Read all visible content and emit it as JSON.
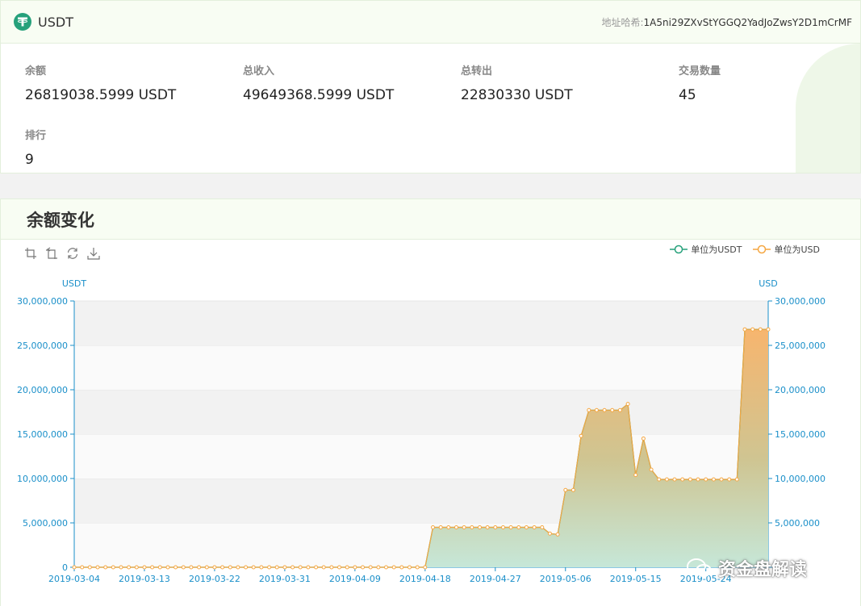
{
  "header": {
    "token_name": "USDT",
    "token_symbol_glyph": "T",
    "address_label": "地址哈希:",
    "address_value": "1A5ni29ZXvStYGGQ2YadJoZwsY2D1mCrMF"
  },
  "stats": [
    {
      "label": "余额",
      "value": "26819038.5999 USDT"
    },
    {
      "label": "总收入",
      "value": "49649368.5999 USDT"
    },
    {
      "label": "总转出",
      "value": "22830330 USDT"
    },
    {
      "label": "交易数量",
      "value": "45"
    },
    {
      "label": "排行",
      "value": "9"
    }
  ],
  "chart_section": {
    "title": "余额变化"
  },
  "toolbox": [
    "zoom-icon",
    "zoom-reset-icon",
    "restore-icon",
    "download-icon"
  ],
  "colors": {
    "accent": "#26a17b",
    "series_usdt": "#26a17b",
    "series_usd": "#f5a742",
    "axis": "#1a8fc9"
  },
  "watermark": {
    "text": "资金盘解读"
  },
  "chart_data": {
    "type": "area",
    "title": "",
    "xlabel": "",
    "ylabel_left": "USDT",
    "ylabel_right": "USD",
    "ylim": [
      0,
      30000000
    ],
    "yticks": [
      "0",
      "5,000,000",
      "10,000,000",
      "15,000,000",
      "20,000,000",
      "25,000,000",
      "30,000,000"
    ],
    "xtick_labels": [
      "2019-03-04",
      "2019-03-13",
      "2019-03-22",
      "2019-03-31",
      "2019-04-09",
      "2019-04-18",
      "2019-04-27",
      "2019-05-06",
      "2019-05-15",
      "2019-05-24"
    ],
    "x_start": "2019-03-04",
    "x_end": "2019-06-01",
    "legend_position": "top-right",
    "grid": true,
    "series": [
      {
        "name": "单位为USDT",
        "values": "same as 单位为USD"
      },
      {
        "name": "单位为USD"
      }
    ],
    "points": [
      [
        "2019-03-04",
        0
      ],
      [
        "2019-03-05",
        0
      ],
      [
        "2019-03-06",
        0
      ],
      [
        "2019-03-07",
        0
      ],
      [
        "2019-03-08",
        0
      ],
      [
        "2019-03-09",
        0
      ],
      [
        "2019-03-10",
        0
      ],
      [
        "2019-03-11",
        0
      ],
      [
        "2019-03-12",
        0
      ],
      [
        "2019-03-13",
        0
      ],
      [
        "2019-03-14",
        0
      ],
      [
        "2019-03-15",
        0
      ],
      [
        "2019-03-16",
        0
      ],
      [
        "2019-03-17",
        0
      ],
      [
        "2019-03-18",
        0
      ],
      [
        "2019-03-19",
        0
      ],
      [
        "2019-03-20",
        0
      ],
      [
        "2019-03-21",
        0
      ],
      [
        "2019-03-22",
        0
      ],
      [
        "2019-03-23",
        0
      ],
      [
        "2019-03-24",
        0
      ],
      [
        "2019-03-25",
        0
      ],
      [
        "2019-03-26",
        0
      ],
      [
        "2019-03-27",
        0
      ],
      [
        "2019-03-28",
        0
      ],
      [
        "2019-03-29",
        0
      ],
      [
        "2019-03-30",
        0
      ],
      [
        "2019-03-31",
        0
      ],
      [
        "2019-04-01",
        0
      ],
      [
        "2019-04-02",
        0
      ],
      [
        "2019-04-03",
        0
      ],
      [
        "2019-04-04",
        0
      ],
      [
        "2019-04-05",
        0
      ],
      [
        "2019-04-06",
        0
      ],
      [
        "2019-04-07",
        0
      ],
      [
        "2019-04-08",
        0
      ],
      [
        "2019-04-09",
        0
      ],
      [
        "2019-04-10",
        0
      ],
      [
        "2019-04-11",
        0
      ],
      [
        "2019-04-12",
        0
      ],
      [
        "2019-04-13",
        0
      ],
      [
        "2019-04-14",
        0
      ],
      [
        "2019-04-15",
        0
      ],
      [
        "2019-04-16",
        0
      ],
      [
        "2019-04-17",
        0
      ],
      [
        "2019-04-18",
        0
      ],
      [
        "2019-04-19",
        4500000
      ],
      [
        "2019-04-20",
        4500000
      ],
      [
        "2019-04-21",
        4500000
      ],
      [
        "2019-04-22",
        4500000
      ],
      [
        "2019-04-23",
        4500000
      ],
      [
        "2019-04-24",
        4500000
      ],
      [
        "2019-04-25",
        4500000
      ],
      [
        "2019-04-26",
        4500000
      ],
      [
        "2019-04-27",
        4500000
      ],
      [
        "2019-04-28",
        4500000
      ],
      [
        "2019-04-29",
        4500000
      ],
      [
        "2019-04-30",
        4500000
      ],
      [
        "2019-05-01",
        4500000
      ],
      [
        "2019-05-02",
        4500000
      ],
      [
        "2019-05-03",
        4500000
      ],
      [
        "2019-05-04",
        3800000
      ],
      [
        "2019-05-05",
        3700000
      ],
      [
        "2019-05-06",
        8700000
      ],
      [
        "2019-05-07",
        8700000
      ],
      [
        "2019-05-08",
        14800000
      ],
      [
        "2019-05-09",
        17700000
      ],
      [
        "2019-05-10",
        17700000
      ],
      [
        "2019-05-11",
        17700000
      ],
      [
        "2019-05-12",
        17700000
      ],
      [
        "2019-05-13",
        17700000
      ],
      [
        "2019-05-14",
        18400000
      ],
      [
        "2019-05-15",
        10400000
      ],
      [
        "2019-05-16",
        14500000
      ],
      [
        "2019-05-17",
        11000000
      ],
      [
        "2019-05-18",
        9900000
      ],
      [
        "2019-05-19",
        9900000
      ],
      [
        "2019-05-20",
        9900000
      ],
      [
        "2019-05-21",
        9900000
      ],
      [
        "2019-05-22",
        9900000
      ],
      [
        "2019-05-23",
        9900000
      ],
      [
        "2019-05-24",
        9900000
      ],
      [
        "2019-05-25",
        9900000
      ],
      [
        "2019-05-26",
        9900000
      ],
      [
        "2019-05-27",
        9900000
      ],
      [
        "2019-05-28",
        9900000
      ],
      [
        "2019-05-29",
        26800000
      ],
      [
        "2019-05-30",
        26800000
      ],
      [
        "2019-05-31",
        26800000
      ],
      [
        "2019-06-01",
        26800000
      ]
    ]
  }
}
